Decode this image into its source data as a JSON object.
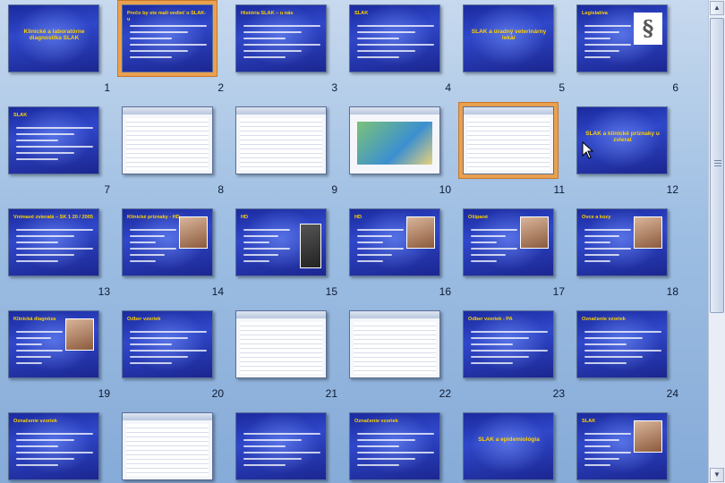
{
  "slides": [
    {
      "n": "1",
      "title": "Klinické a laboratórne diagnostika SLAK",
      "kind": "text",
      "layout": "center-title"
    },
    {
      "n": "2",
      "title": "Prečo by ste mali vedieť o SLAK-u",
      "kind": "text",
      "selected": true
    },
    {
      "n": "3",
      "title": "História SLAK – u nás",
      "kind": "text"
    },
    {
      "n": "4",
      "title": "SLAK",
      "kind": "text"
    },
    {
      "n": "5",
      "title": "SLAK a úradný veterinárny lekár",
      "kind": "text",
      "layout": "center-title"
    },
    {
      "n": "6",
      "title": "Legislatíva",
      "kind": "image",
      "icon": "paragraph-icon"
    },
    {
      "n": "7",
      "title": "SLAK",
      "kind": "text"
    },
    {
      "n": "8",
      "title": "",
      "kind": "screenshot"
    },
    {
      "n": "9",
      "title": "",
      "kind": "screenshot"
    },
    {
      "n": "10",
      "title": "",
      "kind": "map"
    },
    {
      "n": "11",
      "title": "",
      "kind": "screenshot",
      "selected": true
    },
    {
      "n": "12",
      "title": "SLAK a klinické príznaky u zvierat",
      "kind": "text",
      "layout": "center-title"
    },
    {
      "n": "13",
      "title": "Vnímavé zvieratá – SK 1 20 / 2005",
      "kind": "text"
    },
    {
      "n": "14",
      "title": "Klinické príznaky - HD",
      "kind": "image"
    },
    {
      "n": "15",
      "title": "HD",
      "kind": "image-tall"
    },
    {
      "n": "16",
      "title": "HD",
      "kind": "image"
    },
    {
      "n": "17",
      "title": "Ošípané",
      "kind": "image"
    },
    {
      "n": "18",
      "title": "Ovce a kozy",
      "kind": "image"
    },
    {
      "n": "19",
      "title": "Klinická diagnóza",
      "kind": "image"
    },
    {
      "n": "20",
      "title": "Odber vzoriek",
      "kind": "text"
    },
    {
      "n": "21",
      "title": "",
      "kind": "screenshot"
    },
    {
      "n": "22",
      "title": "",
      "kind": "screenshot"
    },
    {
      "n": "23",
      "title": "Odber vzoriek - PA",
      "kind": "text"
    },
    {
      "n": "24",
      "title": "Označenie vzoriek",
      "kind": "text"
    },
    {
      "n": "",
      "title": "Označenie vzoriek",
      "kind": "text"
    },
    {
      "n": "",
      "title": "",
      "kind": "screenshot"
    },
    {
      "n": "",
      "title": "",
      "kind": "text"
    },
    {
      "n": "",
      "title": "Označenie vzoriek",
      "kind": "text"
    },
    {
      "n": "",
      "title": "SLAK a epidemiológia",
      "kind": "text",
      "layout": "center-title"
    },
    {
      "n": "",
      "title": "SLAK",
      "kind": "image"
    }
  ],
  "scrollbar": {
    "up_glyph": "▲",
    "down_glyph": "▼"
  }
}
